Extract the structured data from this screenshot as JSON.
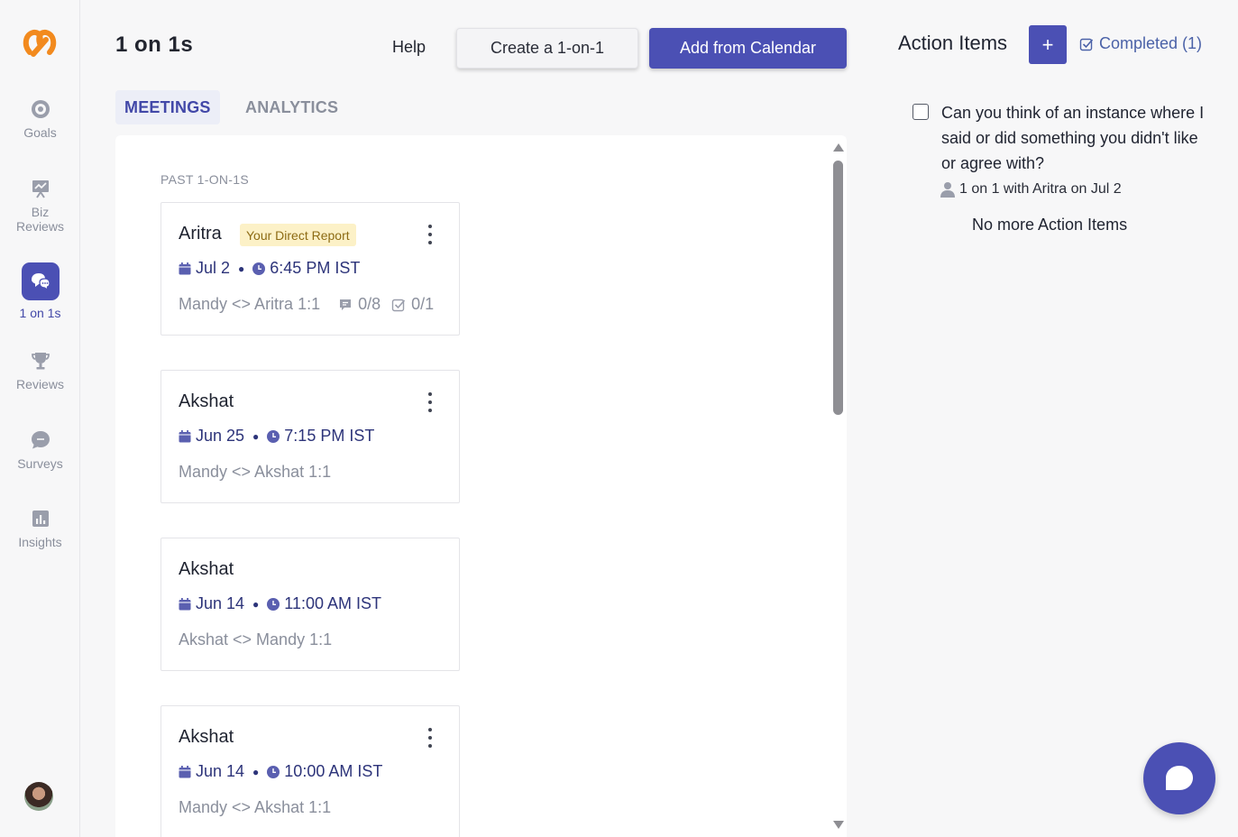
{
  "sidebar": {
    "items": [
      {
        "label": "Goals",
        "icon": "target-icon"
      },
      {
        "label": "Biz\nReviews",
        "icon": "presentation-icon"
      },
      {
        "label": "1 on 1s",
        "icon": "chat-bubbles-icon",
        "active": true
      },
      {
        "label": "Reviews",
        "icon": "trophy-icon"
      },
      {
        "label": "Surveys",
        "icon": "speech-bubble-icon"
      },
      {
        "label": "Insights",
        "icon": "bar-chart-icon"
      }
    ]
  },
  "header": {
    "title": "1 on 1s",
    "help_label": "Help",
    "create_label": "Create a 1-on-1",
    "calendar_label": "Add from Calendar"
  },
  "tabs": [
    {
      "label": "MEETINGS",
      "active": true
    },
    {
      "label": "ANALYTICS",
      "active": false
    }
  ],
  "meetings": {
    "section_label": "PAST 1-ON-1S",
    "cards": [
      {
        "name": "Aritra",
        "badge": "Your Direct Report",
        "date": "Jul 2",
        "time": "6:45 PM IST",
        "title": "Mandy <> Aritra 1:1",
        "talking_points": "0/8",
        "action_items": "0/1"
      },
      {
        "name": "Akshat",
        "date": "Jun 25",
        "time": "7:15 PM IST",
        "title": "Mandy <> Akshat 1:1"
      },
      {
        "name": "Akshat",
        "date": "Jun 14",
        "time": "11:00 AM IST",
        "title": "Akshat <> Mandy 1:1"
      },
      {
        "name": "Akshat",
        "date": "Jun 14",
        "time": "10:00 AM IST",
        "title": "Mandy <> Akshat 1:1"
      }
    ]
  },
  "action_items": {
    "title": "Action Items",
    "add_label": "+",
    "completed_label": "Completed (1)",
    "items": [
      {
        "text": "Can you think of an instance where I said or did something you didn't like or agree with?",
        "source": "1 on 1 with Aritra on Jul 2",
        "checked": false
      }
    ],
    "empty_label": "No more Action Items"
  },
  "colors": {
    "accent": "#4b50b4",
    "badge_bg": "#fcf1c7",
    "badge_text": "#8d6b14",
    "date_text": "#2d347a",
    "muted": "#8a8f9c",
    "logo": "#f28a1e"
  }
}
